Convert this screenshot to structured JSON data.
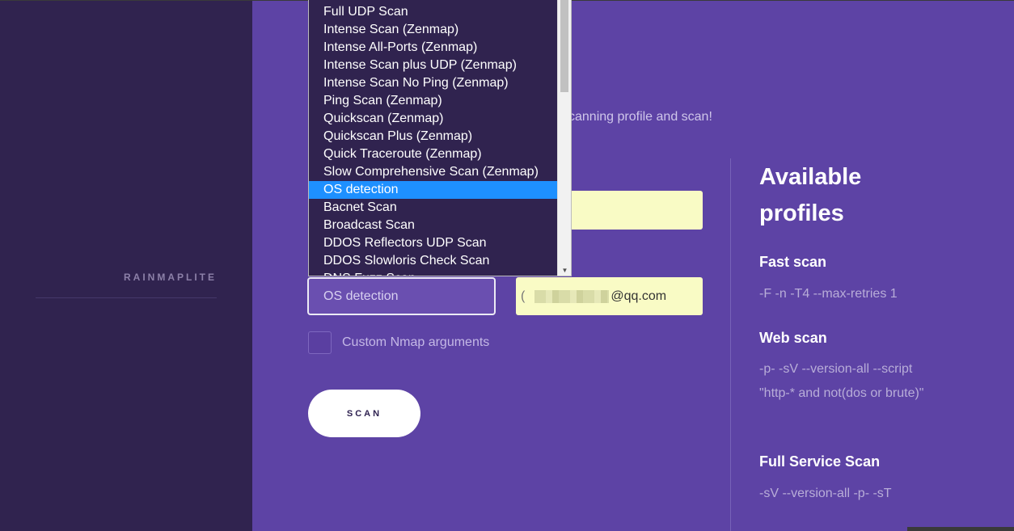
{
  "sidebar": {
    "brand": "RAINMAPLITE"
  },
  "main": {
    "subtitle_partial": "canning profile and scan!",
    "profile_select": {
      "value": "OS detection"
    },
    "email_field": {
      "prefix": "(",
      "suffix": "@qq.com"
    },
    "custom_args": {
      "label": "Custom Nmap arguments",
      "checked": false
    },
    "scan_button": {
      "label": "SCAN"
    }
  },
  "dropdown": {
    "options": [
      "Full UDP Scan",
      "Intense Scan (Zenmap)",
      "Intense All-Ports (Zenmap)",
      "Intense Scan plus UDP (Zenmap)",
      "Intense Scan No Ping (Zenmap)",
      "Ping Scan (Zenmap)",
      "Quickscan (Zenmap)",
      "Quickscan Plus (Zenmap)",
      "Quick Traceroute (Zenmap)",
      "Slow Comprehensive Scan (Zenmap)",
      "OS detection",
      "Bacnet Scan",
      "Broadcast Scan",
      "DDOS Reflectors UDP Scan",
      "DDOS Slowloris Check Scan",
      "DNS Fuzz Scan"
    ],
    "selected": "OS detection"
  },
  "profiles": {
    "heading": "Available profiles",
    "items": [
      {
        "name": "Fast scan",
        "args": "-F -n -T4 --max-retries 1"
      },
      {
        "name": "Web scan",
        "args": "-p- -sV --version-all --script \"http-* and not(dos or brute)\""
      },
      {
        "name": "Full Service Scan",
        "args": "-sV --version-all -p- -sT"
      }
    ]
  },
  "colors": {
    "sidebar_bg": "#30234f",
    "main_bg": "#5d43a5",
    "dropdown_bg": "#30234f",
    "selected_option": "#1e90ff",
    "input_yellow": "#f9fbc5"
  }
}
